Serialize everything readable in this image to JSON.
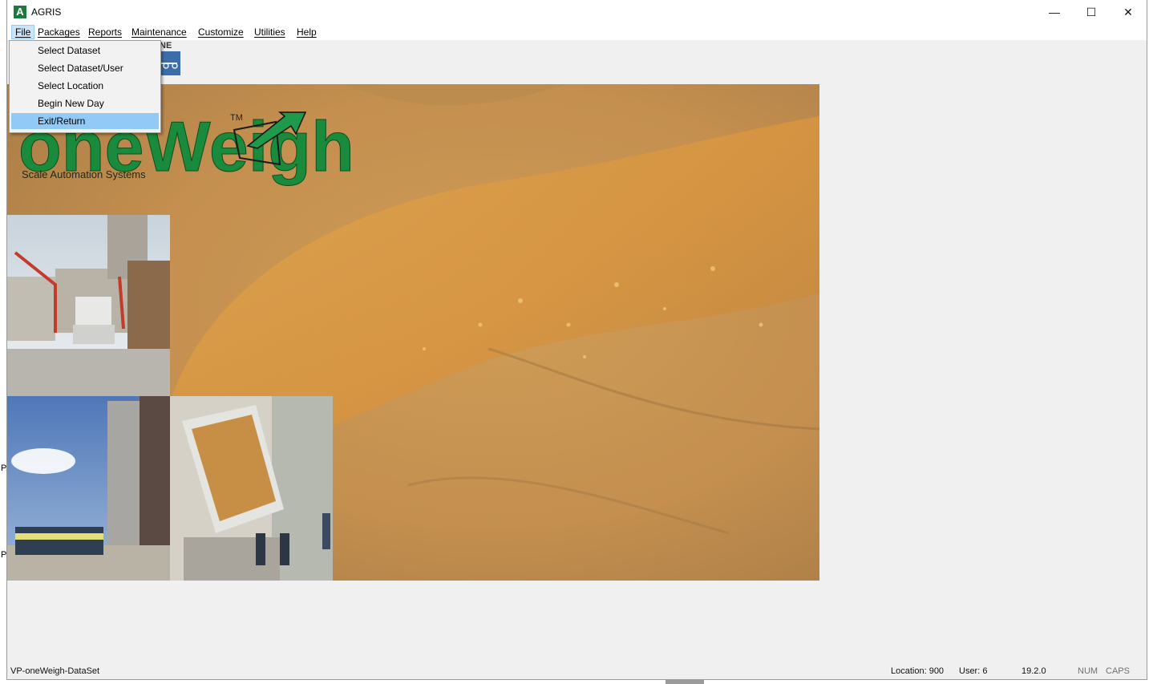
{
  "window": {
    "title": "AGRIS",
    "app_icon_letter": "A",
    "minimize": "—",
    "maximize": "☐",
    "close": "✕"
  },
  "menu": {
    "items": [
      "File",
      "Packages",
      "Reports",
      "Maintenance",
      "Customize",
      "Utilities",
      "Help"
    ],
    "file_dropdown": [
      "Select Dataset",
      "Select Dataset/User",
      "Select Location",
      "Begin New Day",
      "Exit/Return"
    ]
  },
  "toolbar": {
    "fragment_text": "NE"
  },
  "banner": {
    "logo_text": "oneWeigh",
    "trademark": "TM",
    "tagline": "Scale Automation Systems"
  },
  "status": {
    "dataset": "VP-oneWeigh-DataSet",
    "location": "Location: 900",
    "user": "User: 6",
    "version": "19.2.0",
    "num": "NUM",
    "caps": "CAPS"
  },
  "edge_chars": [
    "P",
    "P"
  ],
  "colors": {
    "brand_green": "#1a8a3c",
    "highlight": "#91c9f7",
    "grain": "#c9964f"
  }
}
